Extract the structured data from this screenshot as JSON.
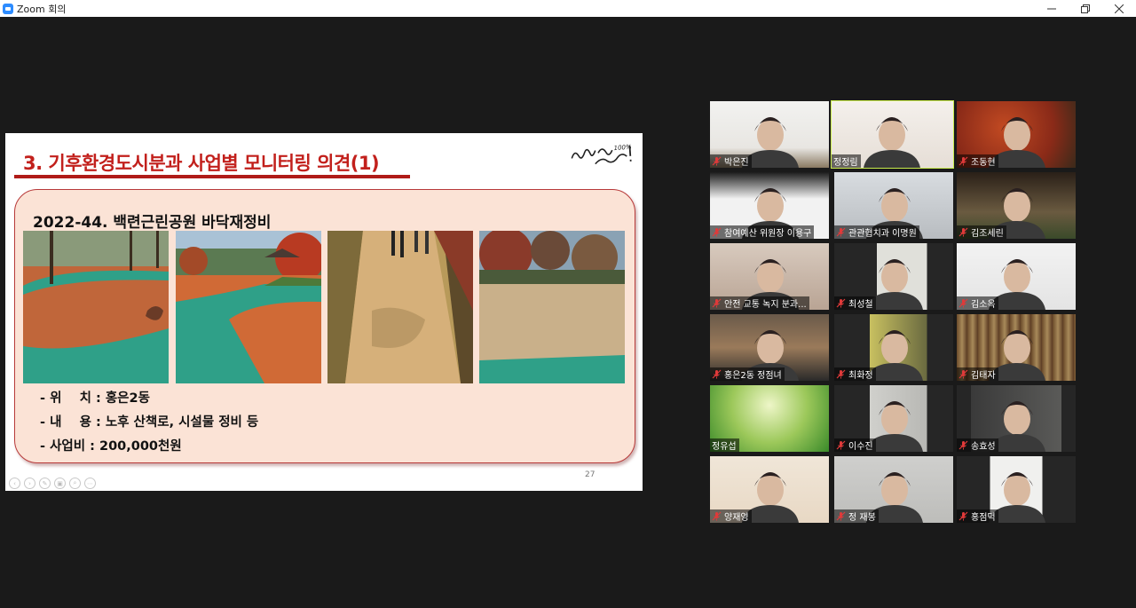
{
  "window": {
    "title": "Zoom 회의",
    "controls": [
      "minimize-icon",
      "restore-icon",
      "close-icon"
    ]
  },
  "slide": {
    "title": "3. 기후환경도시분과 사업별 모니터링 의견(1)",
    "logo_text": "행복100% 서대문!",
    "heading": "2022-44. 백련근린공원 바닥재정비",
    "details": [
      "- 위    치 : 홍은2동",
      "- 내    용 : 노후 산책로, 시설물 정비 등",
      "- 사업비 : 200,000천원"
    ],
    "page_number": "27"
  },
  "participants": [
    {
      "name": "박은진",
      "muted": true,
      "speaking": false
    },
    {
      "name": "정정림",
      "muted": false,
      "speaking": true
    },
    {
      "name": "조동현",
      "muted": true,
      "speaking": false
    },
    {
      "name": "참여예산 위원장 이용구",
      "muted": true,
      "speaking": false
    },
    {
      "name": "관관협치과 이명원",
      "muted": true,
      "speaking": false
    },
    {
      "name": "김조세린",
      "muted": true,
      "speaking": false
    },
    {
      "name": "안전 교통 녹지 분과...",
      "muted": true,
      "speaking": false
    },
    {
      "name": "최성철",
      "muted": true,
      "speaking": false
    },
    {
      "name": "김소옥",
      "muted": true,
      "speaking": false
    },
    {
      "name": "홍은2동 정점녀",
      "muted": true,
      "speaking": false
    },
    {
      "name": "최화정",
      "muted": true,
      "speaking": false
    },
    {
      "name": "김태자",
      "muted": true,
      "speaking": false
    },
    {
      "name": "정유섭",
      "muted": false,
      "speaking": false
    },
    {
      "name": "이수진",
      "muted": true,
      "speaking": false
    },
    {
      "name": "송효성",
      "muted": true,
      "speaking": false
    },
    {
      "name": "양재영",
      "muted": true,
      "speaking": false
    },
    {
      "name": "정 재봉",
      "muted": true,
      "speaking": false
    },
    {
      "name": "홍점덕",
      "muted": true,
      "speaking": false
    }
  ],
  "colors": {
    "slide_title": "#c2201c",
    "panel_fill": "#fbe3d6",
    "speaking_border": "#c9ec4c",
    "mute_icon": "#e03a3a"
  }
}
